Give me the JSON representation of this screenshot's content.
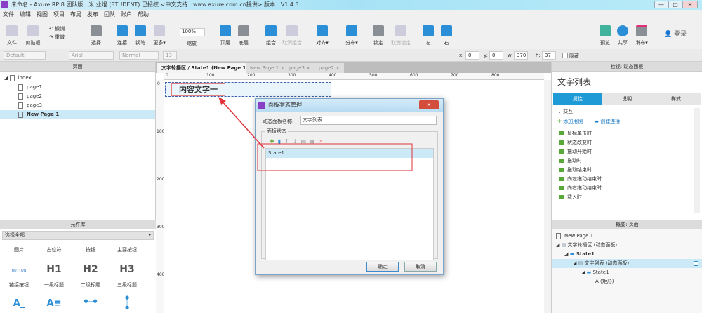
{
  "window": {
    "title": "未命名 - Axure RP 8 团队版 : 米 业焜 (STUDENT) 已授权       <中文支持 : www.axure.com.cn提供> 版本 : V1.4.3",
    "minimize": "—",
    "maximize": "□",
    "close": "✕"
  },
  "menu": [
    "文件",
    "编辑",
    "视图",
    "项目",
    "布局",
    "发布",
    "团队",
    "账户",
    "帮助"
  ],
  "toolbar": {
    "file": "文件",
    "clipboard": "剪贴板",
    "undo": "撤销",
    "redo": "重做",
    "select": "选择",
    "connect": "连接",
    "pen": "钢笔",
    "more": "更多▾",
    "zoom": "100%",
    "zoom_label": "缩放",
    "top": "顶层",
    "bottom": "底层",
    "group": "组合",
    "ungroup": "取消组合",
    "align": "对齐▾",
    "distribute": "分布▾",
    "lock": "锁定",
    "unlock": "取消锁定",
    "left": "左",
    "right": "右",
    "preview": "预览",
    "share": "共享",
    "publish": "发布▾",
    "login": "登录"
  },
  "format": {
    "style": "Default",
    "font": "Arial",
    "weight": "Normal",
    "size": "13",
    "x_label": "x:",
    "x": "0",
    "y_label": "y:",
    "y": "0",
    "w_label": "w:",
    "w": "370",
    "h_label": "h:",
    "h": "37",
    "hidden": "隐藏"
  },
  "pages": {
    "title": "页面",
    "items": [
      "index",
      "page1",
      "page2",
      "page3",
      "New Page 1"
    ]
  },
  "library": {
    "title": "元件库",
    "select": "选择全部",
    "row1": [
      "图片",
      "占位符",
      "按钮",
      "主要按钮"
    ],
    "row2_glyph": [
      "BUTTON",
      "H1",
      "H2",
      "H3"
    ],
    "row2": [
      "链接按钮",
      "一级标题",
      "二级标题",
      "三级标题"
    ]
  },
  "canvas": {
    "tabs": [
      "文字轮播区 / State1 (New Page 1)",
      "New Page 1",
      "page3",
      "page2"
    ],
    "ruler": [
      "0",
      "100",
      "200",
      "300",
      "400",
      "500",
      "600",
      "700",
      "800"
    ],
    "vruler": [
      "0",
      "100",
      "200",
      "300",
      "400"
    ],
    "widget_text": "内容文字一"
  },
  "inspector": {
    "title": "检视: 动态面板",
    "name": "文字列表",
    "tabs": [
      "属性",
      "说明",
      "样式"
    ],
    "section": "交互",
    "add_case": "添加用例",
    "create_link": "创建连接",
    "events": [
      "鼠标单击时",
      "状态改变时",
      "拖动开始时",
      "拖动时",
      "拖动结束时",
      "向左拖动结束时",
      "向右拖动结束时",
      "载入时"
    ]
  },
  "outline": {
    "title": "概要: 页面",
    "items": [
      "New Page 1",
      "文字轮播区 (动态面板)",
      "State1",
      "文字列表 (动态面板)",
      "State1",
      "(矩形)"
    ]
  },
  "dialog": {
    "title": "面板状态管理",
    "name_label": "动态面板名称:",
    "name_value": "文字列表",
    "group": "面板状态",
    "states": [
      "State1"
    ],
    "ok": "确定",
    "cancel": "取消"
  },
  "colors": {
    "accent": "#1e9ad6",
    "annotation": "#e0333a"
  }
}
